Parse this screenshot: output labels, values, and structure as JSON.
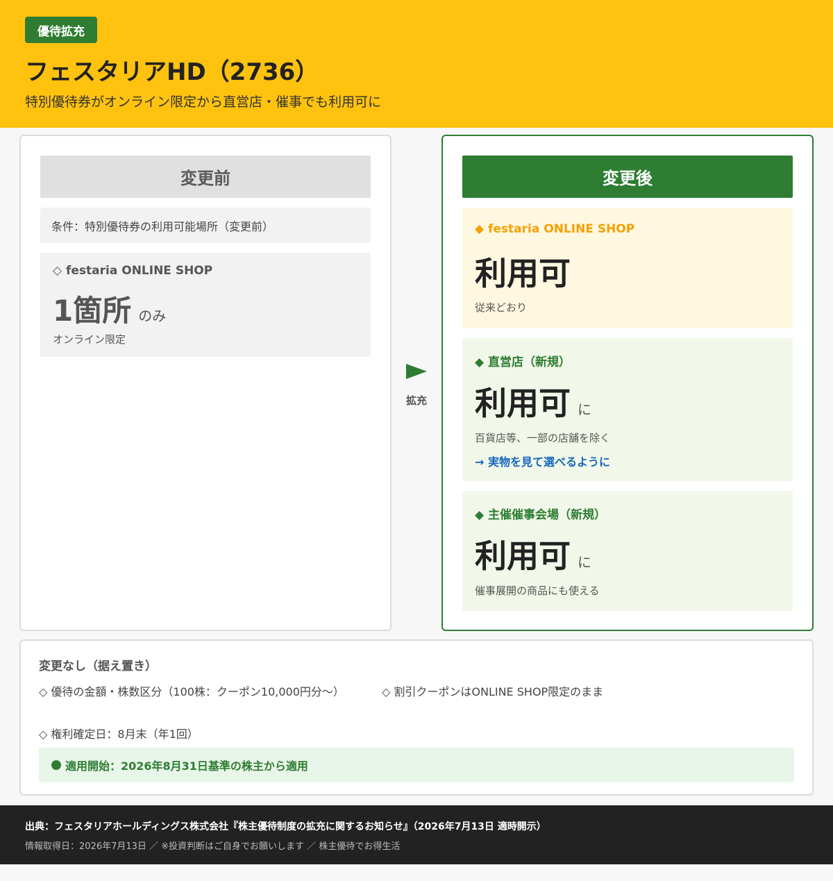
{
  "header": {
    "badge": "優待拡充",
    "title": "フェスタリアHD（2736）",
    "subtitle": "特別優待券がオンライン限定から直営店・催事でも利用可に"
  },
  "before": {
    "heading": "変更前",
    "condition": "条件：特別優待券の利用可能場所（変更前）",
    "card": {
      "label": "◇ festaria ONLINE SHOP",
      "value": "1箇所",
      "suffix": "のみ",
      "note": "オンライン限定"
    }
  },
  "arrow": {
    "label": "拡充"
  },
  "after": {
    "heading": "変更後",
    "cards": [
      {
        "label": "◆ festaria ONLINE SHOP",
        "value": "利用可",
        "suffix": "",
        "note": "従来どおり",
        "link": ""
      },
      {
        "label": "◆ 直営店（新規）",
        "value": "利用可",
        "suffix": "に",
        "note": "百貨店等、一部の店舗を除く",
        "link": "→ 実物を見て選べるように"
      },
      {
        "label": "◆ 主催催事会場（新規）",
        "value": "利用可",
        "suffix": "に",
        "note": "催事展開の商品にも使える",
        "link": ""
      }
    ]
  },
  "unchanged": {
    "title": "変更なし（据え置き）",
    "items": [
      "◇ 優待の金額・株数区分（100株：クーポン10,000円分〜）",
      "◇ 割引クーポンはONLINE SHOP限定のまま",
      "◇ 権利確定日：8月末（年1回）"
    ],
    "start": "適用開始：2026年8月31日基準の株主から適用"
  },
  "footer": {
    "source": "出典：フェスタリアホールディングス株式会社『株主優待制度の拡充に関するお知らせ』（2026年7月13日 適時開示）",
    "info": "情報取得日：2026年7月13日 ／ ※投資判断はご自身でお願いします ／ 株主優待でお得生活"
  },
  "colors": {
    "header_bg": "#ffc20e",
    "accent_green": "#2e7d32",
    "online_orange": "#f5a000",
    "link_blue": "#1565c0"
  }
}
